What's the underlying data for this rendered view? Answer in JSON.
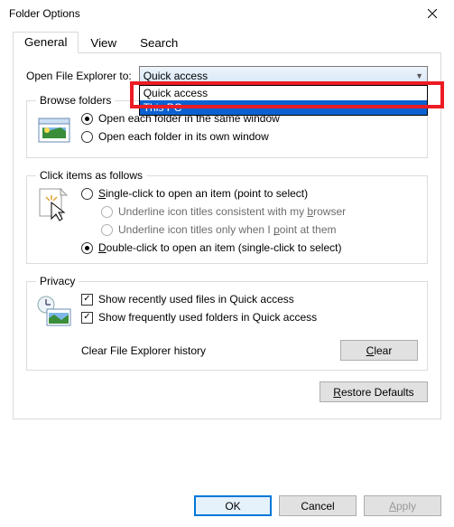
{
  "window": {
    "title": "Folder Options"
  },
  "tabs": {
    "general": "General",
    "view": "View",
    "search": "Search"
  },
  "open_to": {
    "label": "Open File Explorer to:",
    "selected": "Quick access",
    "options": {
      "quick": "Quick access",
      "thispc": "This PC"
    }
  },
  "browse": {
    "legend": "Browse folders",
    "same": "Open each folder in the same window",
    "own": "Open each folder in its own window"
  },
  "click": {
    "legend": "Click items as follows",
    "single": "Single-click to open an item (point to select)",
    "u1": "Underline icon titles consistent with my browser",
    "u2": "Underline icon titles only when I point at them",
    "double": "Double-click to open an item (single-click to select)"
  },
  "privacy": {
    "legend": "Privacy",
    "recent": "Show recently used files in Quick access",
    "freq": "Show frequently used folders in Quick access",
    "clear_label": "Clear File Explorer history",
    "clear_btn": "Clear"
  },
  "restore": "Restore Defaults",
  "buttons": {
    "ok": "OK",
    "cancel": "Cancel",
    "apply": "Apply"
  }
}
